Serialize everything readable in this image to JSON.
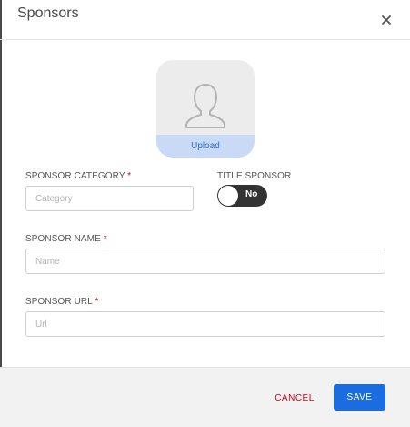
{
  "dialog": {
    "title": "Sponsors",
    "close_icon": "close-icon"
  },
  "avatar": {
    "icon": "user-placeholder-icon",
    "upload_label": "Upload"
  },
  "fields": {
    "category": {
      "label": "SPONSOR CATEGORY",
      "required_mark": "*",
      "placeholder": "Category",
      "value": ""
    },
    "title_sponsor": {
      "label": "TITLE SPONSOR",
      "toggle_text": "No",
      "enabled": false
    },
    "name": {
      "label": "SPONSOR NAME",
      "required_mark": "*",
      "placeholder": "Name",
      "value": ""
    },
    "url": {
      "label": "SPONSOR URL",
      "required_mark": "*",
      "placeholder": "Url",
      "value": ""
    }
  },
  "footer": {
    "cancel_label": "CANCEL",
    "save_label": "SAVE"
  },
  "colors": {
    "primary": "#1a6ce0",
    "danger": "#d0021b",
    "toggle_off": "#333333",
    "upload_bar": "#c8daf6"
  }
}
